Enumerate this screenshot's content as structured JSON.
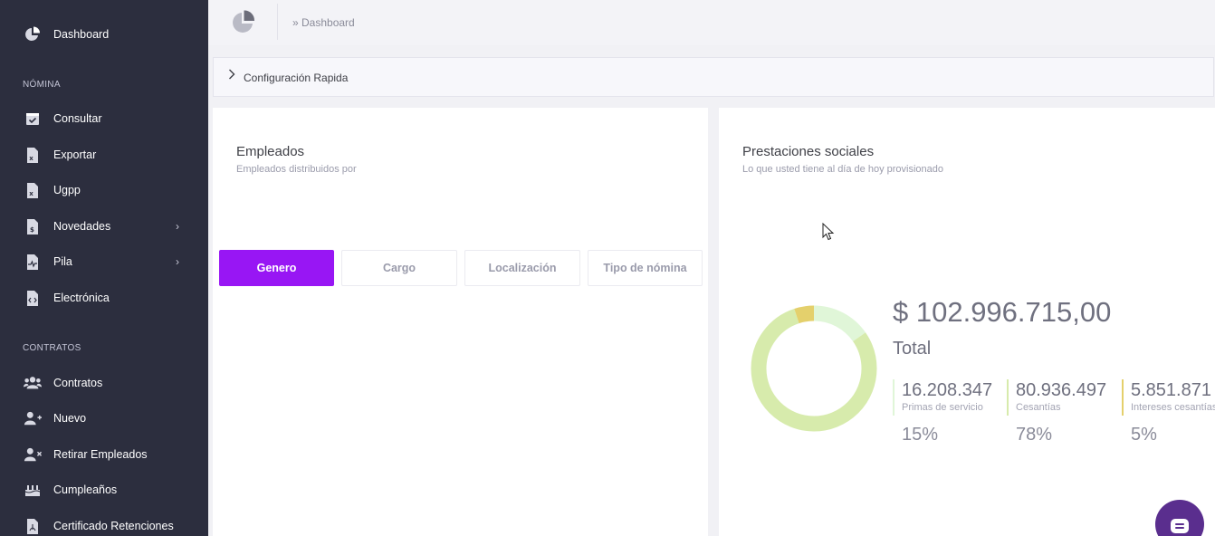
{
  "sidebar": {
    "top_item": {
      "label": "Dashboard",
      "icon": "pie-chart-icon"
    },
    "sections": [
      {
        "title": "NÓMINA",
        "items": [
          {
            "label": "Consultar",
            "icon": "calendar-check-icon"
          },
          {
            "label": "Exportar",
            "icon": "excel-file-icon"
          },
          {
            "label": "Ugpp",
            "icon": "excel-file-icon"
          },
          {
            "label": "Novedades",
            "icon": "money-file-icon",
            "chevron": "›"
          },
          {
            "label": "Pila",
            "icon": "pulse-file-icon",
            "chevron": "›"
          },
          {
            "label": "Electrónica",
            "icon": "code-file-icon"
          }
        ]
      },
      {
        "title": "CONTRATOS",
        "items": [
          {
            "label": "Contratos",
            "icon": "users-icon"
          },
          {
            "label": "Nuevo",
            "icon": "user-plus-icon"
          },
          {
            "label": "Retirar Empleados",
            "icon": "user-remove-icon"
          },
          {
            "label": "Cumpleaños",
            "icon": "birthday-cake-icon"
          },
          {
            "label": "Certificado Retenciones",
            "icon": "pdf-file-icon"
          }
        ]
      }
    ]
  },
  "header": {
    "breadcrumb": "» Dashboard"
  },
  "quick_config": {
    "label": "Configuración Rapida"
  },
  "empleados": {
    "title": "Empleados",
    "subtitle": "Empleados distribuidos por",
    "tabs": [
      {
        "label": "Genero",
        "active": true
      },
      {
        "label": "Cargo",
        "active": false
      },
      {
        "label": "Localización",
        "active": false
      },
      {
        "label": "Tipo de nómina",
        "active": false
      }
    ]
  },
  "prestaciones": {
    "title": "Prestaciones sociales",
    "subtitle": "Lo que usted tiene al día de hoy provisionado",
    "total_amount": "$ 102.996.715,00",
    "total_label": "Total",
    "items": [
      {
        "value": "16.208.347",
        "name": "Primas de servicio",
        "percent": "15%",
        "fraction": 0.15,
        "color": "#e0f6d8"
      },
      {
        "value": "80.936.497",
        "name": "Cesantías",
        "percent": "78%",
        "fraction": 0.78,
        "color": "#d7ebac"
      },
      {
        "value": "5.851.871",
        "name": "Intereses cesantías",
        "percent": "5%",
        "fraction": 0.05,
        "color": "#e4d06c"
      }
    ]
  },
  "colors": {
    "sidebar_bg": "#2c2e3e",
    "accent_purple": "#9816f4",
    "chat_button": "#5a2e8e"
  }
}
